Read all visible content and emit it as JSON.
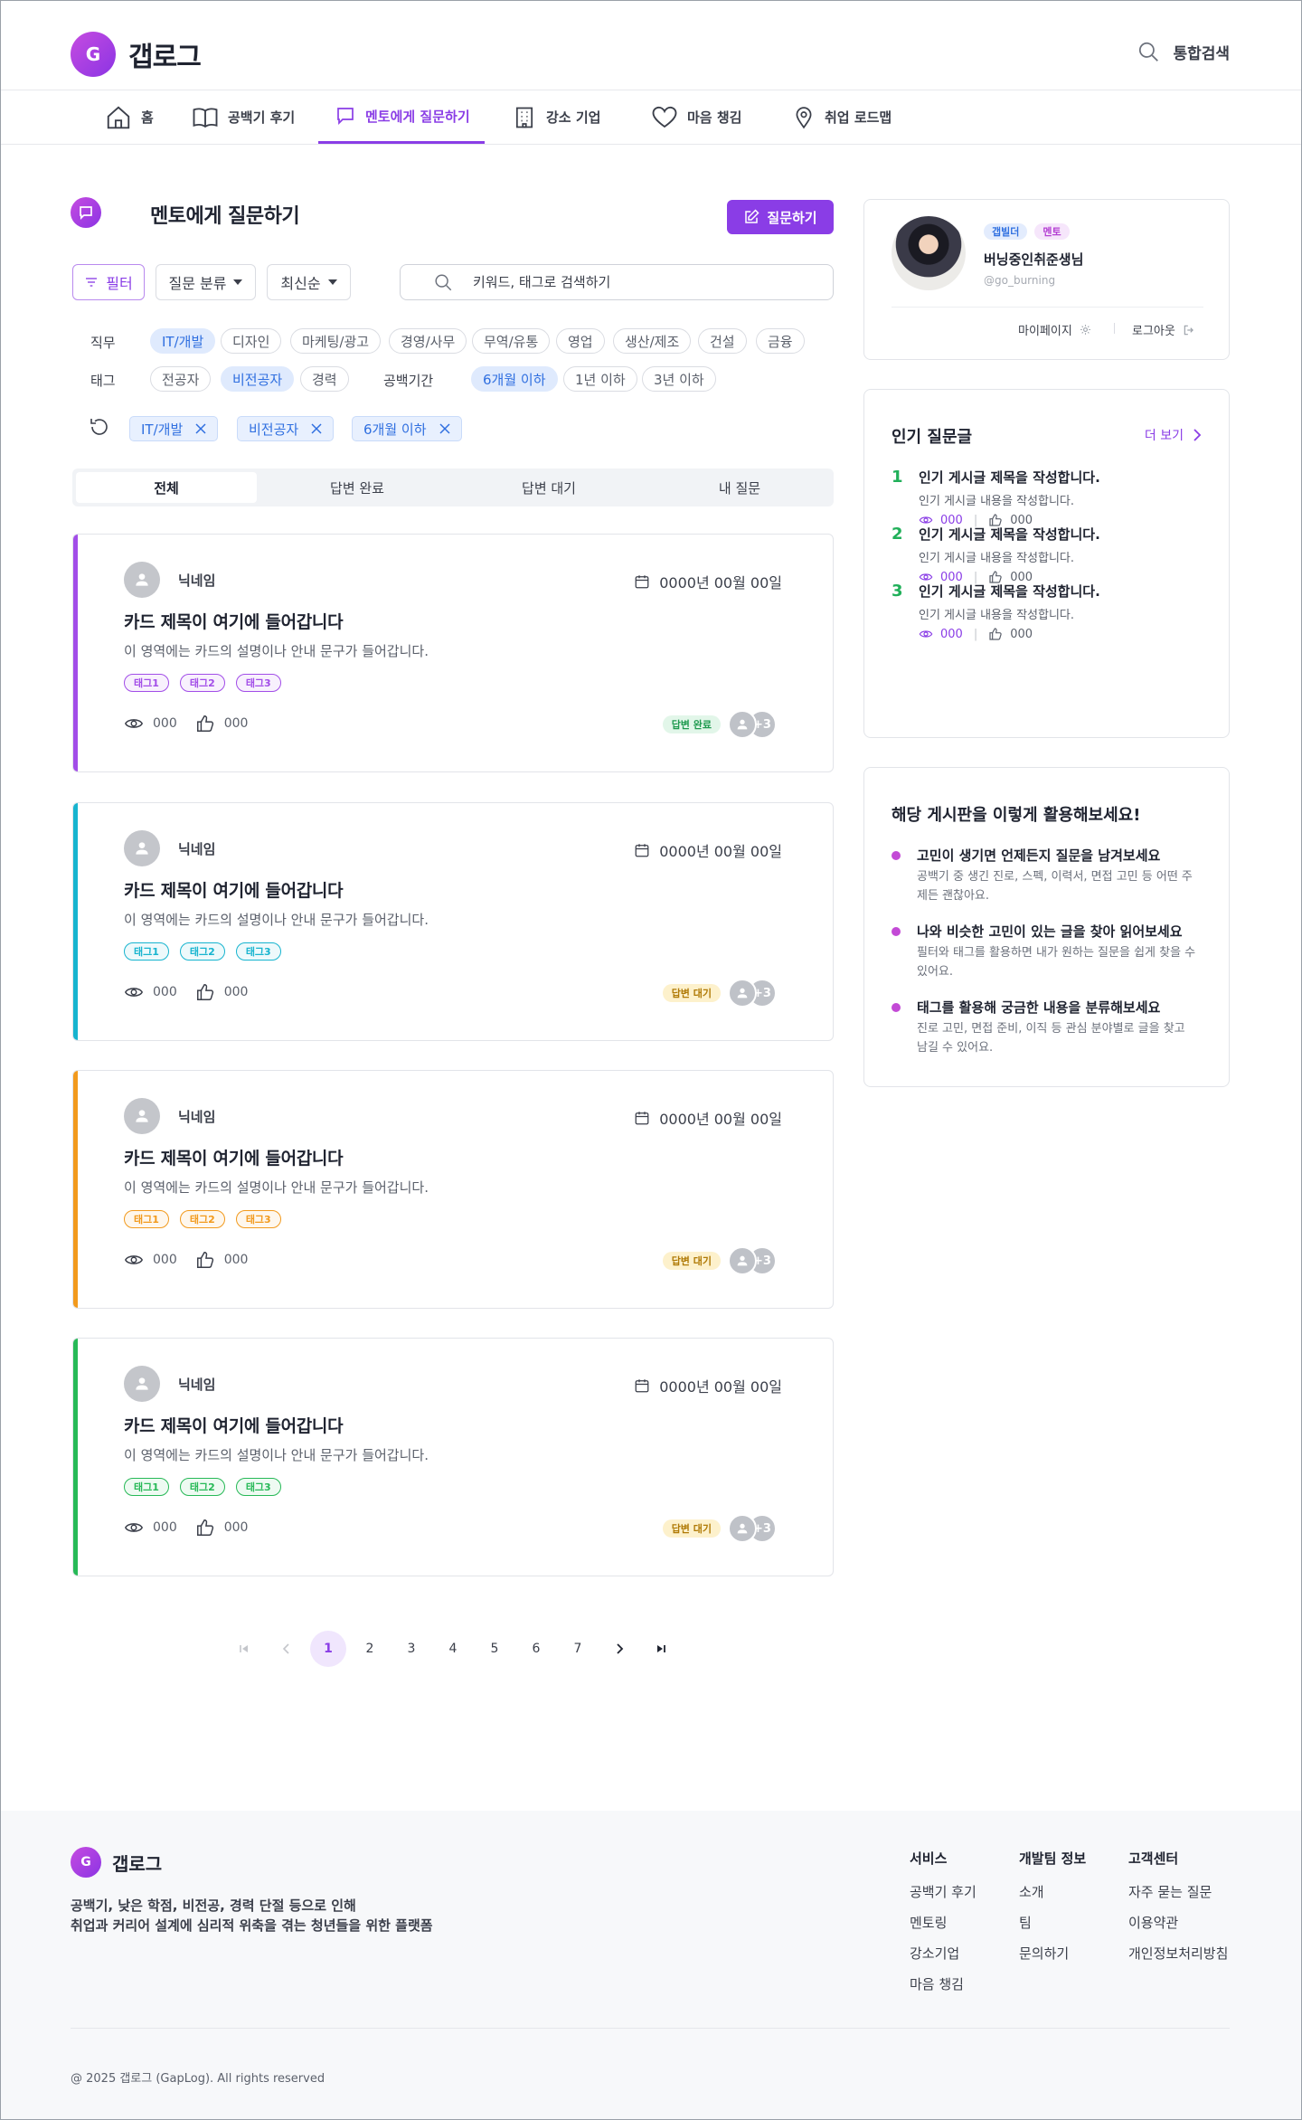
{
  "header": {
    "logo_letter": "G",
    "logo_text": "갭로그",
    "search_label": "통합검색"
  },
  "nav": [
    {
      "label": "홈",
      "icon": "home-icon"
    },
    {
      "label": "공백기 후기",
      "icon": "book-icon"
    },
    {
      "label": "멘토에게 질문하기",
      "icon": "chat-icon",
      "active": true
    },
    {
      "label": "강소 기업",
      "icon": "building-icon"
    },
    {
      "label": "마음 챙김",
      "icon": "heart-icon"
    },
    {
      "label": "취업 로드맵",
      "icon": "location-icon"
    }
  ],
  "page": {
    "title": "멘토에게 질문하기",
    "ask_button": "질문하기"
  },
  "filters": {
    "filter_button": "필터",
    "category_dropdown": "질문 분류",
    "sort_dropdown": "최신순",
    "search_placeholder": "키워드, 태그로 검색하기",
    "job_label": "직무",
    "tag_label": "태그",
    "gap_label": "공백기간",
    "jobs": [
      "IT/개발",
      "디자인",
      "마케팅/광고",
      "경영/사무",
      "무역/유통",
      "영업",
      "생산/제조",
      "건설",
      "금융"
    ],
    "tags": [
      "전공자",
      "비전공자",
      "경력"
    ],
    "gaps": [
      "6개월 이하",
      "1년 이하",
      "3년 이하"
    ],
    "applied": [
      "IT/개발",
      "비전공자",
      "6개월 이하"
    ]
  },
  "tabs": [
    "전체",
    "답변 완료",
    "답변 대기",
    "내 질문"
  ],
  "cards": [
    {
      "nickname": "닉네임",
      "date": "0000년 00월 00일",
      "title": "카드 제목이 여기에 들어갑니다",
      "desc": "이 영역에는 카드의 설명이나 안내 문구가 들어갑니다.",
      "tags": [
        "태그1",
        "태그2",
        "태그3"
      ],
      "views": "000",
      "likes": "000",
      "status": "답변 완료",
      "mentor_more": "+3",
      "accent": "#a24de8"
    },
    {
      "nickname": "닉네임",
      "date": "0000년 00월 00일",
      "title": "카드 제목이 여기에 들어갑니다",
      "desc": "이 영역에는 카드의 설명이나 안내 문구가 들어갑니다.",
      "tags": [
        "태그1",
        "태그2",
        "태그3"
      ],
      "views": "000",
      "likes": "000",
      "status": "답변 대기",
      "mentor_more": "+3",
      "accent": "#17b4cf"
    },
    {
      "nickname": "닉네임",
      "date": "0000년 00월 00일",
      "title": "카드 제목이 여기에 들어갑니다",
      "desc": "이 영역에는 카드의 설명이나 안내 문구가 들어갑니다.",
      "tags": [
        "태그1",
        "태그2",
        "태그3"
      ],
      "views": "000",
      "likes": "000",
      "status": "답변 대기",
      "mentor_more": "+3",
      "accent": "#f29a1d"
    },
    {
      "nickname": "닉네임",
      "date": "0000년 00월 00일",
      "title": "카드 제목이 여기에 들어갑니다",
      "desc": "이 영역에는 카드의 설명이나 안내 문구가 들어갑니다.",
      "tags": [
        "태그1",
        "태그2",
        "태그3"
      ],
      "views": "000",
      "likes": "000",
      "status": "답변 대기",
      "mentor_more": "+3",
      "accent": "#27b957"
    }
  ],
  "pagination": {
    "pages": [
      "1",
      "2",
      "3",
      "4",
      "5",
      "6",
      "7"
    ],
    "current": "1"
  },
  "profile": {
    "badge1": "갭빌더",
    "badge2": "멘토",
    "name": "버닝중인취준생님",
    "handle": "@go_burning",
    "mypage": "마이페이지",
    "logout": "로그아웃"
  },
  "popular": {
    "title": "인기 질문글",
    "more": "더 보기",
    "items": [
      {
        "num": "1",
        "title": "인기 게시글 제목을 작성합니다.",
        "desc": "인기 게시글 내용을 작성합니다.",
        "views": "000",
        "likes": "000"
      },
      {
        "num": "2",
        "title": "인기 게시글 제목을 작성합니다.",
        "desc": "인기 게시글 내용을 작성합니다.",
        "views": "000",
        "likes": "000"
      },
      {
        "num": "3",
        "title": "인기 게시글 제목을 작성합니다.",
        "desc": "인기 게시글 내용을 작성합니다.",
        "views": "000",
        "likes": "000"
      }
    ]
  },
  "tips": {
    "title": "해당 게시판을 이렇게 활용해보세요!",
    "items": [
      {
        "title": "고민이 생기면 언제든지 질문을 남겨보세요",
        "desc": "공백기 중 생긴 진로, 스펙, 이력서, 면접 고민 등 어떤 주제든 괜찮아요."
      },
      {
        "title": "나와 비슷한 고민이 있는 글을 찾아 읽어보세요",
        "desc": "필터와 태그를 활용하면 내가 원하는 질문을 쉽게 찾을 수 있어요."
      },
      {
        "title": "태그를 활용해 궁금한 내용을 분류해보세요",
        "desc": "진로 고민, 면접 준비, 이직 등 관심 분야별로 글을 찾고 남길 수 있어요."
      }
    ]
  },
  "footer": {
    "logo_letter": "G",
    "logo_text": "갭로그",
    "desc1": "공백기, 낮은 학점, 비전공, 경력 단절 등으로 인해",
    "desc2": "취업과 커리어 설계에 심리적 위축을 겪는 청년들을 위한 플랫폼",
    "cols": [
      {
        "title": "서비스",
        "links": [
          "공백기 후기",
          "멘토링",
          "강소기업",
          "마음 챙김"
        ]
      },
      {
        "title": "개발팀 정보",
        "links": [
          "소개",
          "팀",
          "문의하기"
        ]
      },
      {
        "title": "고객센터",
        "links": [
          "자주 묻는 질문",
          "이용약관",
          "개인정보처리방침"
        ]
      }
    ],
    "copyright": "@ 2025 갭로그 (GapLog). All rights reserved"
  },
  "colors": {
    "primary": "#8a3de6",
    "chip_selected": "#dfeafd",
    "rank": "#21b05a"
  }
}
